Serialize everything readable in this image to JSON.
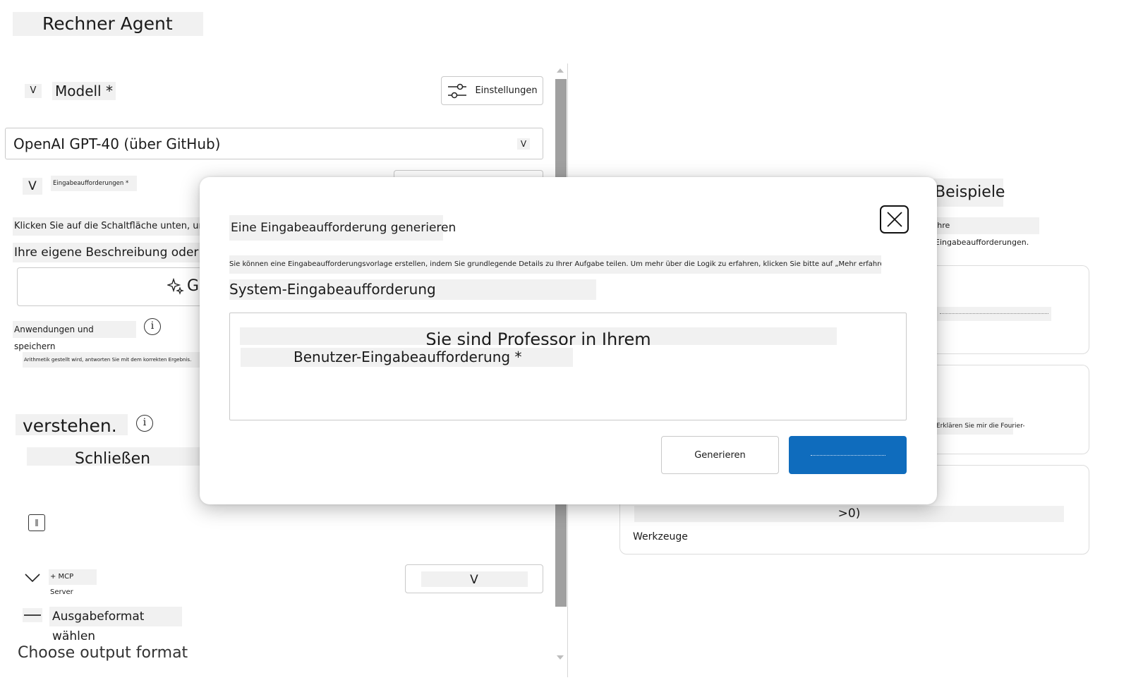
{
  "app": {
    "title": "Rechner Agent"
  },
  "left": {
    "model_section": {
      "chevron": "V",
      "label": "Modell *",
      "settings_label": "Einstellungen"
    },
    "model_select": {
      "value": "OpenAI GPT-40 (über GitHub)",
      "chevron": "V"
    },
    "prompts_section": {
      "chevron": "V",
      "label": "Eingabeaufforderungen *"
    },
    "instruction_line1": "Klicken Sie auf die Schaltfläche unten, um",
    "instruction_line2": "Ihre eigene Beschreibung oder",
    "generate_button_label": "G",
    "apply_save_label": "Anwendungen und speichern",
    "system_preview": "Arithmetik gestellt wird, antworten Sie mit dem korrekten Ergebnis.",
    "understand_label": "verstehen.",
    "close_label": "Schließen",
    "mcp_label": "+ MCP Server",
    "mcp_select_chevron": "V",
    "output_format_label": "Ausgabeformat wählen",
    "output_format_placeholder": "Choose output format"
  },
  "right": {
    "title": "Beispiele",
    "subtitle": "Ihre Eingabeaufforderungen.",
    "card2_text": "Erklären Sie mir die Fourier-",
    "card3_text": ">0)",
    "card3_tools": "Werkzeuge"
  },
  "modal": {
    "title": "Eine Eingabeaufforderung generieren",
    "description": "Sie können eine Eingabeaufforderungsvorlage erstellen, indem Sie grundlegende Details zu Ihrer Aufgabe teilen. Um mehr über die Logik zu erfahren, klicken Sie bitte auf „Mehr erfahren“.",
    "system_label": "System-Eingabeaufforderung",
    "textarea_line1": "Sie sind Professor in Ihrem",
    "textarea_line2": "Benutzer-Eingabeaufforderung *",
    "secondary_button": "Generieren"
  }
}
